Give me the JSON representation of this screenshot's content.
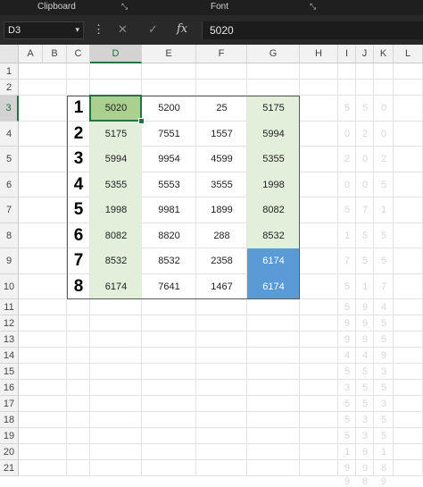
{
  "ribbon": {
    "groups": [
      {
        "label": "Clipboard",
        "launcher": "dialog-launcher-icon"
      },
      {
        "label": "Font",
        "launcher": "dialog-launcher-icon"
      }
    ],
    "launcher_glyph": "⤡"
  },
  "formula_bar": {
    "name_box": "D3",
    "name_box_dropdown": "▾",
    "menu_glyph": "⋮",
    "cancel_glyph": "✕",
    "enter_glyph": "✓",
    "fx_glyph": "fx",
    "content": "5020"
  },
  "columns": [
    "A",
    "B",
    "C",
    "D",
    "E",
    "F",
    "G",
    "H",
    "I",
    "J",
    "K",
    "L"
  ],
  "selected_column": "D",
  "rows": [
    "1",
    "2",
    "3",
    "4",
    "5",
    "6",
    "7",
    "8",
    "9",
    "10",
    "11",
    "12",
    "13",
    "14",
    "15",
    "16",
    "17",
    "18",
    "19",
    "20",
    "21"
  ],
  "selected_row": "3",
  "table": {
    "row_labels": [
      "1",
      "2",
      "3",
      "4",
      "5",
      "6",
      "7",
      "8"
    ],
    "values": [
      [
        "5020",
        "5200",
        "25",
        "5175"
      ],
      [
        "5175",
        "7551",
        "1557",
        "5994"
      ],
      [
        "5994",
        "9954",
        "4599",
        "5355"
      ],
      [
        "5355",
        "5553",
        "3555",
        "1998"
      ],
      [
        "1998",
        "9981",
        "1899",
        "8082"
      ],
      [
        "8082",
        "8820",
        "288",
        "8532"
      ],
      [
        "8532",
        "8532",
        "2358",
        "6174"
      ],
      [
        "6174",
        "7641",
        "1467",
        "6174"
      ]
    ]
  },
  "faint_digits": [
    [
      "5",
      "5",
      "0"
    ],
    [
      "0",
      "2",
      "0"
    ],
    [
      "2",
      "0",
      "2"
    ],
    [
      "0",
      "0",
      "5"
    ],
    [
      "5",
      "7",
      "1"
    ],
    [
      "1",
      "5",
      "5"
    ],
    [
      "7",
      "5",
      "5"
    ],
    [
      "5",
      "1",
      "7"
    ],
    [
      "5",
      "9",
      "4"
    ],
    [
      "9",
      "9",
      "5"
    ],
    [
      "9",
      "9",
      "5"
    ],
    [
      "4",
      "4",
      "9"
    ],
    [
      "5",
      "5",
      "3"
    ],
    [
      "3",
      "5",
      "5"
    ],
    [
      "5",
      "5",
      "3"
    ],
    [
      "5",
      "3",
      "5"
    ],
    [
      "5",
      "3",
      "5"
    ],
    [
      "1",
      "9",
      "1"
    ],
    [
      "9",
      "9",
      "8"
    ],
    [
      "9",
      "8",
      "9"
    ]
  ],
  "colors": {
    "active_cell": "#a9d08e",
    "green_fill": "#e2efda",
    "blue_fill": "#5b9bd5",
    "excel_green": "#217346"
  }
}
